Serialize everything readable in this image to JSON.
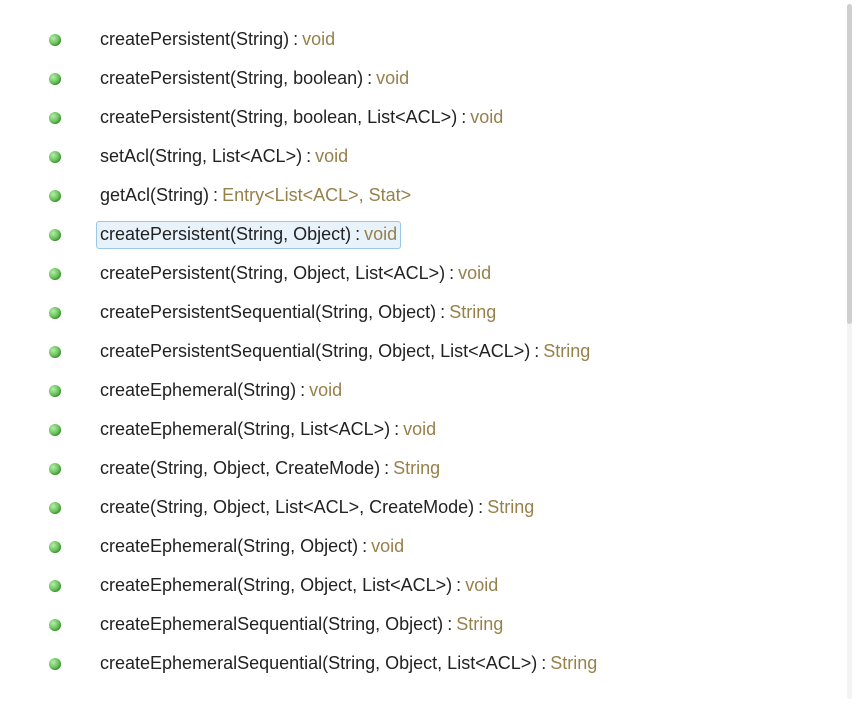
{
  "outline": {
    "items": [
      {
        "signature": "createPersistent(String)",
        "returnType": "void",
        "selected": false
      },
      {
        "signature": "createPersistent(String, boolean)",
        "returnType": "void",
        "selected": false
      },
      {
        "signature": "createPersistent(String, boolean, List<ACL>)",
        "returnType": "void",
        "selected": false
      },
      {
        "signature": "setAcl(String, List<ACL>)",
        "returnType": "void",
        "selected": false
      },
      {
        "signature": "getAcl(String)",
        "returnType": "Entry<List<ACL>, Stat>",
        "selected": false
      },
      {
        "signature": "createPersistent(String, Object)",
        "returnType": "void",
        "selected": true
      },
      {
        "signature": "createPersistent(String, Object, List<ACL>)",
        "returnType": "void",
        "selected": false
      },
      {
        "signature": "createPersistentSequential(String, Object)",
        "returnType": "String",
        "selected": false
      },
      {
        "signature": "createPersistentSequential(String, Object, List<ACL>)",
        "returnType": "String",
        "selected": false
      },
      {
        "signature": "createEphemeral(String)",
        "returnType": "void",
        "selected": false
      },
      {
        "signature": "createEphemeral(String, List<ACL>)",
        "returnType": "void",
        "selected": false
      },
      {
        "signature": "create(String, Object, CreateMode)",
        "returnType": "String",
        "selected": false
      },
      {
        "signature": "create(String, Object, List<ACL>, CreateMode)",
        "returnType": "String",
        "selected": false
      },
      {
        "signature": "createEphemeral(String, Object)",
        "returnType": "void",
        "selected": false
      },
      {
        "signature": "createEphemeral(String, Object, List<ACL>)",
        "returnType": "void",
        "selected": false
      },
      {
        "signature": "createEphemeralSequential(String, Object)",
        "returnType": "String",
        "selected": false
      },
      {
        "signature": "createEphemeralSequential(String, Object, List<ACL>)",
        "returnType": "String",
        "selected": false
      }
    ]
  },
  "icons": {
    "public_method": "public-method"
  },
  "separator": ":"
}
